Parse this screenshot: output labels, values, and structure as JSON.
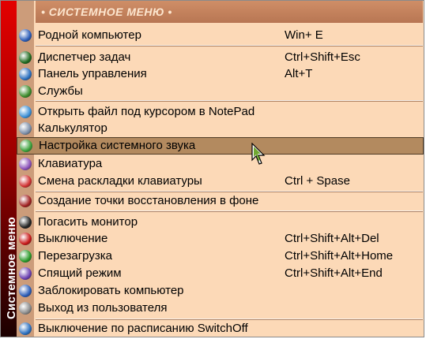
{
  "sidebar": {
    "title": "Системное меню"
  },
  "header": {
    "title": "• СИСТЕМНОЕ МЕНЮ •"
  },
  "items": [
    {
      "label": "Родной компьютер",
      "shortcut": "Win+ E",
      "icon": "computer-icon",
      "color": "#2a5cb8"
    },
    {
      "label": "Диспетчер задач",
      "shortcut": "Ctrl+Shift+Esc",
      "icon": "task-manager-icon",
      "color": "#1f6a1f"
    },
    {
      "label": "Панель управления",
      "shortcut": "Alt+T",
      "icon": "control-panel-icon",
      "color": "#2a6fbf"
    },
    {
      "label": "Службы",
      "shortcut": "",
      "icon": "services-icon",
      "color": "#3a8a2a"
    },
    {
      "label": "Открыть файл под курсором в NotePad",
      "shortcut": "",
      "icon": "notepad-icon",
      "color": "#3b8fd6"
    },
    {
      "label": "Калькулятор",
      "shortcut": "",
      "icon": "calculator-icon",
      "color": "#7b8ea8"
    },
    {
      "label": "Настройка системного звука",
      "shortcut": "",
      "icon": "sound-icon",
      "color": "#3aa03a"
    },
    {
      "label": "Клавиатура",
      "shortcut": "",
      "icon": "keyboard-icon",
      "color": "#8a4fb8"
    },
    {
      "label": "Смена раскладки клавиатуры",
      "shortcut": "Ctrl + Spase",
      "icon": "flag-icon",
      "color": "#d03030"
    },
    {
      "label": "Создание точки восстановления в фоне",
      "shortcut": "",
      "icon": "restore-icon",
      "color": "#a02020"
    },
    {
      "label": "Погасить монитор",
      "shortcut": "",
      "icon": "monitor-icon",
      "color": "#222222"
    },
    {
      "label": "Выключение",
      "shortcut": "Ctrl+Shift+Alt+Del",
      "icon": "power-icon",
      "color": "#c81818"
    },
    {
      "label": "Перезагрузка",
      "shortcut": "Ctrl+Shift+Alt+Home",
      "icon": "restart-icon",
      "color": "#2a9a2a"
    },
    {
      "label": "Спящий режим",
      "shortcut": "Ctrl+Shift+Alt+End",
      "icon": "sleep-icon",
      "color": "#6a3fb0"
    },
    {
      "label": "Заблокировать компьютер",
      "shortcut": "",
      "icon": "lock-icon",
      "color": "#2a5cb8"
    },
    {
      "label": "Выход из пользователя",
      "shortcut": "",
      "icon": "logout-icon",
      "color": "#8a8a8a"
    },
    {
      "label": "Выключение по расписанию SwitchOff",
      "shortcut": "",
      "icon": "schedule-icon",
      "color": "#2a6fbf"
    }
  ],
  "highlighted_item": "Настройка системного звука",
  "colors": {
    "menu_bg": "#fcd9b7",
    "header_bg": "#c07f5b",
    "highlight": "#b38a5f",
    "sidebar_top": "#e30000"
  }
}
